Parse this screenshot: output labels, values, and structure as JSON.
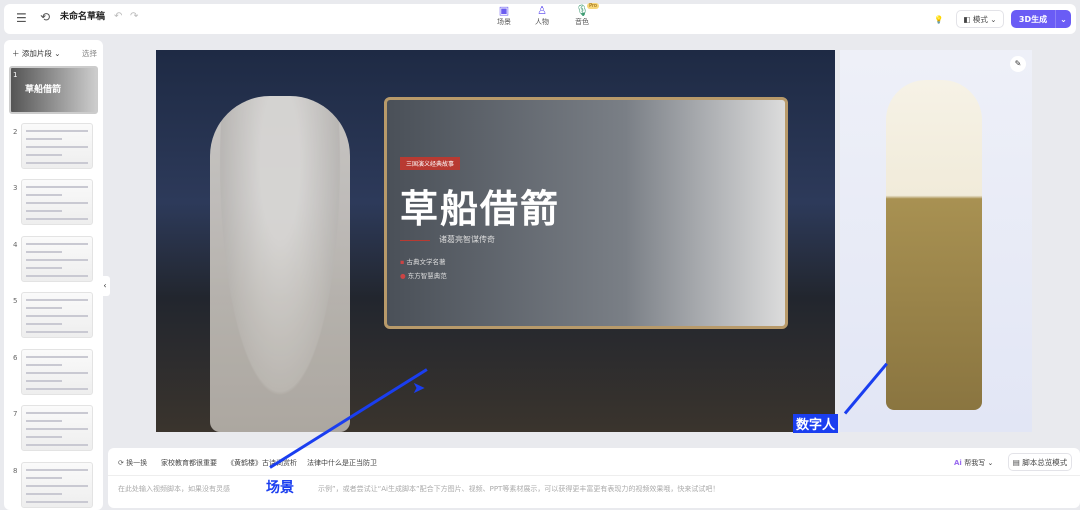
{
  "header": {
    "title": "未命名草稿",
    "nav": [
      {
        "label": "场景",
        "icon": "scene-icon"
      },
      {
        "label": "人物",
        "icon": "person-icon"
      },
      {
        "label": "音色",
        "icon": "mic-icon",
        "badge": "Pro"
      }
    ],
    "mode_label": "模式",
    "generate_label": "3D生成"
  },
  "sidebar": {
    "add_label": "添加片段",
    "select_label": "选择",
    "clips": [
      "1",
      "2",
      "3",
      "4",
      "5",
      "6",
      "7",
      "8"
    ],
    "first_clip_title": "草船借箭"
  },
  "slide": {
    "tag": "三国演义经典故事",
    "title": "草船借箭",
    "subtitle": "诸葛亮智谋传奇",
    "bullets": [
      "古典文学名著",
      "东方智慧典范"
    ]
  },
  "script": {
    "refresh_label": "换一换",
    "topics": [
      "家校教育都很重要",
      "《黄鹤楼》古诗词赏析",
      "法律中什么是正当防卫"
    ],
    "placeholder_a": "在此处输入视频脚本，如果没有灵感",
    "placeholder_b": "示例”，或者尝试让“Ai生成脚本”配合下方图片、视频、PPT等素材展示，可以获得更丰富更有表现力的视频效果哦，快来试试吧！",
    "ai_label": "帮我写",
    "overview_label": "脚本总览模式"
  },
  "annotations": {
    "scene": "场景",
    "avatar": "数字人"
  }
}
